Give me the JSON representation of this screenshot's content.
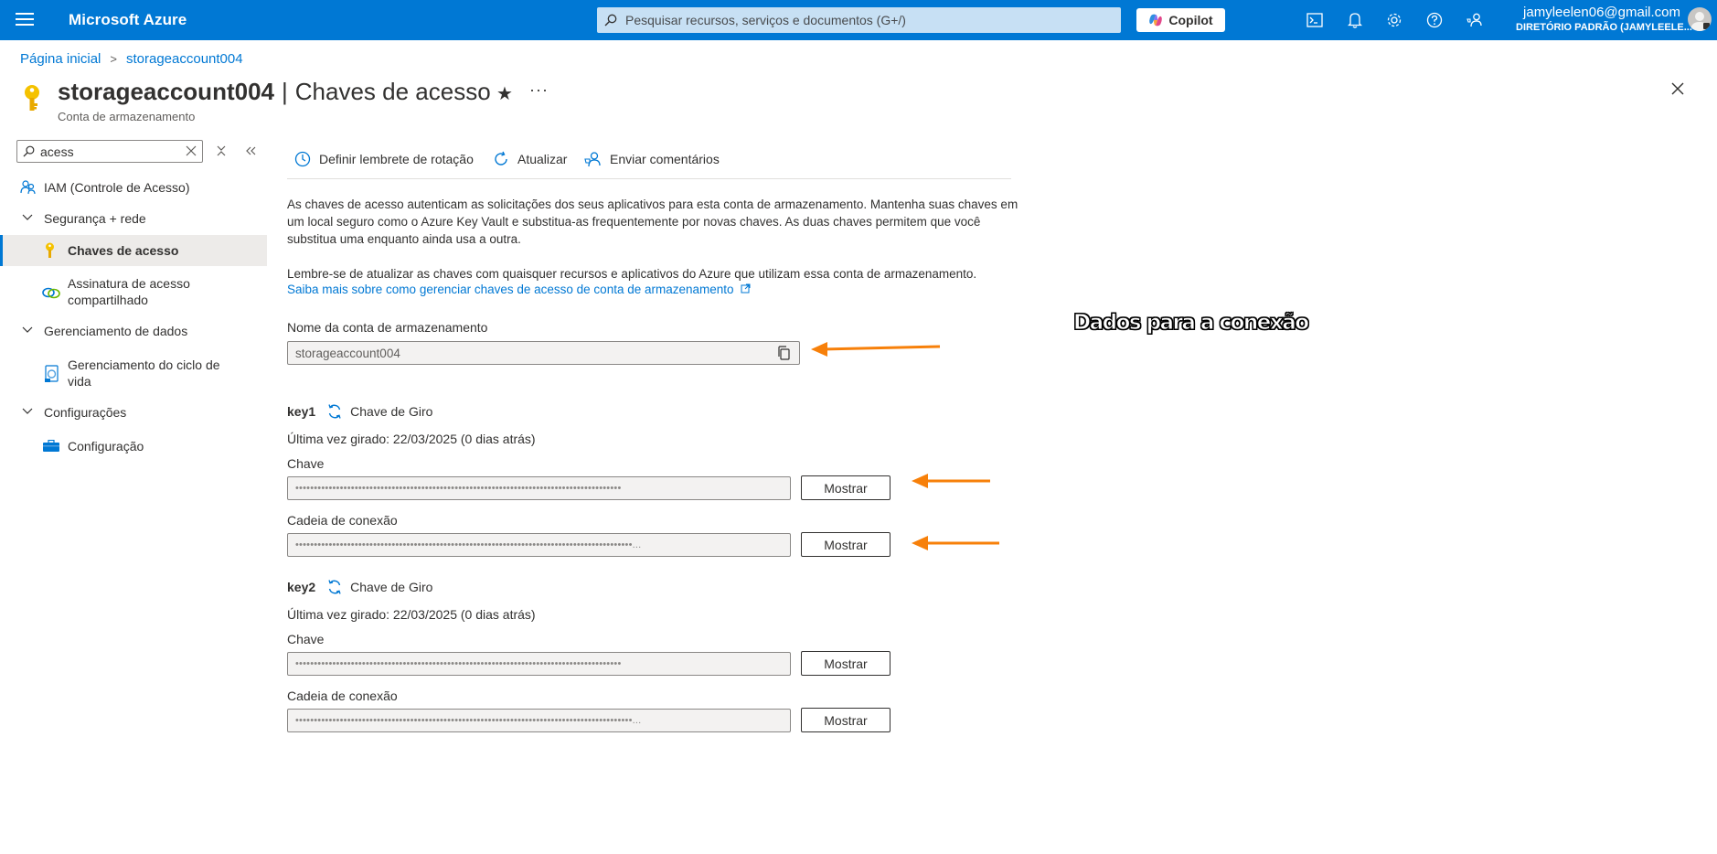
{
  "topbar": {
    "brand": "Microsoft Azure",
    "search_placeholder": "Pesquisar recursos, serviços e documentos (G+/)",
    "copilot_label": "Copilot",
    "icons": [
      "cloud-shell-icon",
      "notifications-icon",
      "settings-icon",
      "help-icon",
      "feedback-icon"
    ],
    "account_email": "jamyleelen06@gmail.com",
    "account_directory": "DIRETÓRIO PADRÃO (JAMYLEELE..."
  },
  "breadcrumb": {
    "home": "Página inicial",
    "separator": ">",
    "current": "storageaccount004"
  },
  "header": {
    "resource_name": "storageaccount004",
    "separator": "|",
    "blade_title": "Chaves de acesso",
    "subtitle": "Conta de armazenamento",
    "star": "★",
    "more": "···"
  },
  "nav": {
    "search_value": "acess",
    "items": [
      {
        "label": "IAM (Controle de Acesso)",
        "icon": "people-icon"
      },
      {
        "label": "Segurança + rede",
        "icon": "chevron-down-icon"
      },
      {
        "label": "Chaves de acesso",
        "icon": "key-icon",
        "selected": true
      },
      {
        "label": "Assinatura de acesso compartilhado",
        "icon": "link-icon"
      },
      {
        "label": "Gerenciamento de dados",
        "icon": "chevron-down-icon"
      },
      {
        "label": "Gerenciamento do ciclo de vida",
        "icon": "lifecycle-icon"
      },
      {
        "label": "Configurações",
        "icon": "chevron-down-icon"
      },
      {
        "label": "Configuração",
        "icon": "toolbox-icon"
      }
    ]
  },
  "commands": {
    "rotation_reminder": "Definir lembrete de rotação",
    "refresh": "Atualizar",
    "feedback": "Enviar comentários"
  },
  "content": {
    "description": "As chaves de acesso autenticam as solicitações dos seus aplicativos para esta conta de armazenamento. Mantenha suas chaves em um local seguro como o Azure Key Vault e substitua-as frequentemente por novas chaves. As duas chaves permitem que você substitua uma enquanto ainda usa a outra.",
    "reminder": "Lembre-se de atualizar as chaves com quaisquer recursos e aplicativos do Azure que utilizam essa conta de armazenamento.",
    "learn_more": "Saiba mais sobre como gerenciar chaves de acesso de conta de armazenamento",
    "account_name_label": "Nome da conta de armazenamento",
    "account_name_value": "storageaccount004",
    "keys": [
      {
        "name": "key1",
        "rotate_label": "Chave de Giro",
        "last_rotated": "Última vez girado: 22/03/2025 (0 dias atrás)",
        "key_label": "Chave",
        "key_masked": "••••••••••••••••••••••••••••••••••••••••••••••••••••••••••••••••••••••••••••••••••••••••",
        "conn_label": "Cadeia de conexão",
        "conn_masked": "•••••••••••••••••••••••••••••••••••••••••••••••••••••••••••••••••••••••••••••••••••••••••••...",
        "show": "Mostrar"
      },
      {
        "name": "key2",
        "rotate_label": "Chave de Giro",
        "last_rotated": "Última vez girado: 22/03/2025 (0 dias atrás)",
        "key_label": "Chave",
        "key_masked": "••••••••••••••••••••••••••••••••••••••••••••••••••••••••••••••••••••••••••••••••••••••••",
        "conn_label": "Cadeia de conexão",
        "conn_masked": "•••••••••••••••••••••••••••••••••••••••••••••••••••••••••••••••••••••••••••••••••••••••••••...",
        "show": "Mostrar"
      }
    ]
  },
  "annotation": {
    "text": "Dados para  a conexão",
    "arrow_color": "#f7800a"
  },
  "colors": {
    "accent": "#0078d4",
    "search_bg": "#c7e0f4",
    "selected_bg": "#edebe9"
  }
}
